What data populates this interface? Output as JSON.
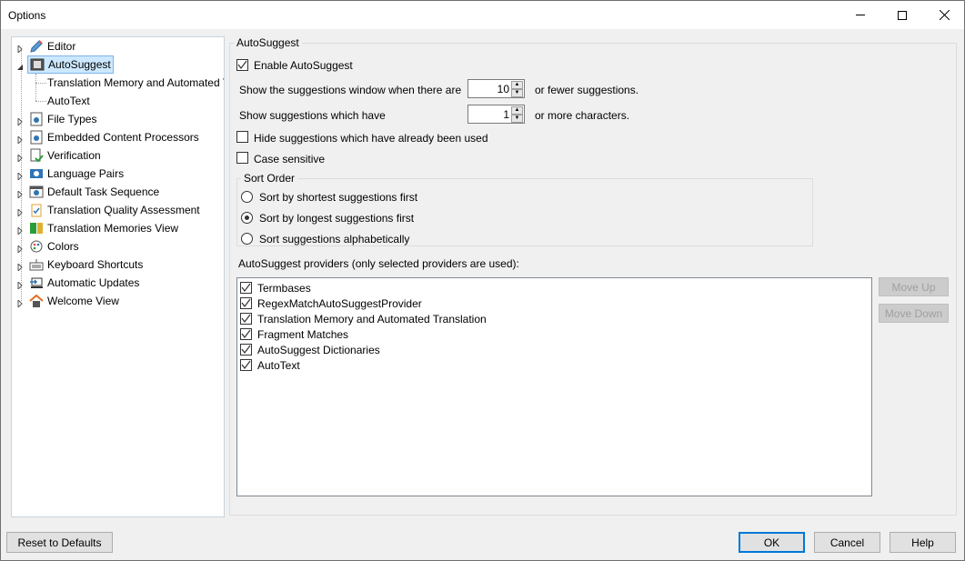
{
  "window": {
    "title": "Options",
    "minimize": "minimize-icon",
    "maximize": "maximize-icon",
    "close": "close-icon"
  },
  "tree": {
    "items": [
      {
        "label": "Editor",
        "icon": "pencil-icon",
        "expander": "collapsed"
      },
      {
        "label": "AutoSuggest",
        "icon": "autosuggest-icon",
        "expander": "expanded",
        "selected": true,
        "children": [
          {
            "label": "Translation Memory and Automated Translation"
          },
          {
            "label": "AutoText"
          }
        ]
      },
      {
        "label": "File Types",
        "icon": "file-gear-icon",
        "expander": "collapsed"
      },
      {
        "label": "Embedded Content Processors",
        "icon": "file-gear-icon",
        "expander": "collapsed"
      },
      {
        "label": "Verification",
        "icon": "verify-check-icon",
        "expander": "collapsed"
      },
      {
        "label": "Language Pairs",
        "icon": "language-pairs-icon",
        "expander": "collapsed"
      },
      {
        "label": "Default Task Sequence",
        "icon": "task-sequence-icon",
        "expander": "collapsed"
      },
      {
        "label": "Translation Quality Assessment",
        "icon": "clipboard-check-icon",
        "expander": "collapsed"
      },
      {
        "label": "Translation Memories View",
        "icon": "tm-view-icon",
        "expander": "collapsed"
      },
      {
        "label": "Colors",
        "icon": "palette-icon",
        "expander": "collapsed"
      },
      {
        "label": "Keyboard Shortcuts",
        "icon": "keyboard-icon",
        "expander": "collapsed"
      },
      {
        "label": "Automatic Updates",
        "icon": "updates-icon",
        "expander": "collapsed"
      },
      {
        "label": "Welcome View",
        "icon": "home-icon",
        "expander": "collapsed"
      }
    ]
  },
  "autosuggest": {
    "group_title": "AutoSuggest",
    "enable": {
      "label": "Enable AutoSuggest",
      "checked": true
    },
    "window_row": {
      "prefix": "Show the suggestions window when there are",
      "value": "10",
      "suffix": "or fewer suggestions."
    },
    "chars_row": {
      "prefix": "Show suggestions which have",
      "value": "1",
      "suffix": "or more characters."
    },
    "hide_used": {
      "label": "Hide suggestions which have already been used",
      "checked": false
    },
    "case_sensitive": {
      "label": "Case sensitive",
      "checked": false
    },
    "sort_order": {
      "title": "Sort Order",
      "options": [
        {
          "label": "Sort by shortest suggestions first",
          "selected": false
        },
        {
          "label": "Sort by longest suggestions first",
          "selected": true
        },
        {
          "label": "Sort suggestions alphabetically",
          "selected": false
        }
      ]
    },
    "providers_label": "AutoSuggest providers (only selected providers are used):",
    "providers": [
      {
        "label": "Termbases",
        "checked": true
      },
      {
        "label": "RegexMatchAutoSuggestProvider",
        "checked": true
      },
      {
        "label": "Translation Memory and Automated Translation",
        "checked": true
      },
      {
        "label": "Fragment Matches",
        "checked": true
      },
      {
        "label": "AutoSuggest Dictionaries",
        "checked": true
      },
      {
        "label": "AutoText",
        "checked": true
      }
    ],
    "move_up": "Move Up",
    "move_down": "Move Down"
  },
  "footer": {
    "reset": "Reset to Defaults",
    "ok": "OK",
    "cancel": "Cancel",
    "help": "Help"
  }
}
